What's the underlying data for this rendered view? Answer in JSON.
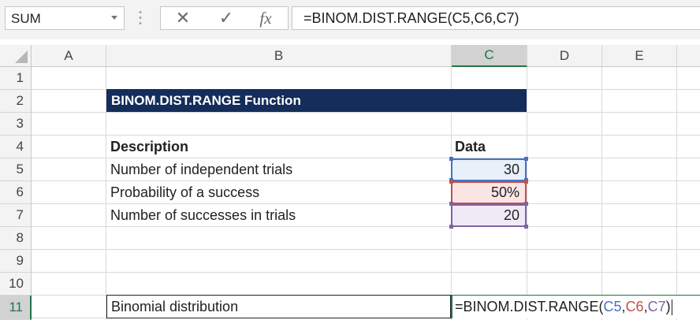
{
  "name_box": {
    "value": "SUM"
  },
  "formula_bar": {
    "cancel_icon": "close-icon",
    "enter_icon": "check-icon",
    "function_icon": "fx-icon",
    "fx_label": "fx",
    "content": "=BINOM.DIST.RANGE(C5,C6,C7)"
  },
  "columns": [
    "A",
    "B",
    "C",
    "D",
    "E"
  ],
  "selected_column": "C",
  "rows": [
    "1",
    "2",
    "3",
    "4",
    "5",
    "6",
    "7",
    "8",
    "9",
    "10",
    "11"
  ],
  "selected_row": "11",
  "sheet": {
    "title": "BINOM.DIST.RANGE  Function",
    "header_description": "Description",
    "header_data": "Data",
    "items": [
      {
        "description": "Number of independent trials",
        "value": "30"
      },
      {
        "description": "Probability of a success",
        "value": "50%"
      },
      {
        "description": "Number of successes in trials",
        "value": "20"
      }
    ],
    "result_label": "Binomial distribution",
    "edit": {
      "prefix": "=BINOM.DIST.RANGE(",
      "ref1": "C5",
      "sep1": ",",
      "ref2": "C6",
      "sep2": ",",
      "ref3": "C7",
      "suffix": ")"
    }
  },
  "colors": {
    "title_bg": "#142d5a",
    "ref1": "#4472c4",
    "ref2": "#c0504d",
    "ref3": "#8064a2",
    "selection": "#217346"
  }
}
